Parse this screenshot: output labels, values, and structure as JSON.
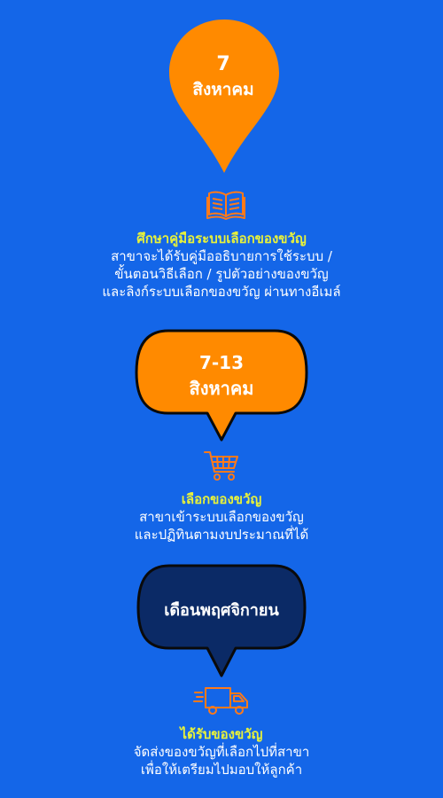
{
  "colors": {
    "background": "#1466e8",
    "orange": "#ff8a00",
    "navy": "#0b2a66",
    "title_yellow": "#e8f23a",
    "icon_orange": "#ff7a1a"
  },
  "step1": {
    "date_day": "7",
    "date_month": "สิงหาคม",
    "icon": "open-book-icon",
    "title": "ศึกษาคู่มือระบบเลือกของขวัญ",
    "lines": [
      "สาขาจะได้รับคู่มืออธิบายการใช้ระบบ /",
      "ขั้นตอนวิธีเลือก / รูปตัวอย่างของขวัญ",
      "และลิงก์ระบบเลือกของขวัญ ผ่านทางอีเมล์"
    ]
  },
  "step2": {
    "date_range": "7-13",
    "date_month": "สิงหาคม",
    "icon": "shopping-cart-icon",
    "title": "เลือกของขวัญ",
    "lines": [
      "สาขาเข้าระบบเลือกของขวัญ",
      "และปฏิทินตามงบประมาณที่ได้"
    ]
  },
  "step3": {
    "date_label": "เดือนพฤศจิกายน",
    "icon": "delivery-truck-icon",
    "title": "ได้รับของขวัญ",
    "lines": [
      "จัดส่งของขวัญที่เลือกไปที่สาขา",
      "เพื่อให้เตรียมไปมอบให้ลูกค้า"
    ]
  }
}
